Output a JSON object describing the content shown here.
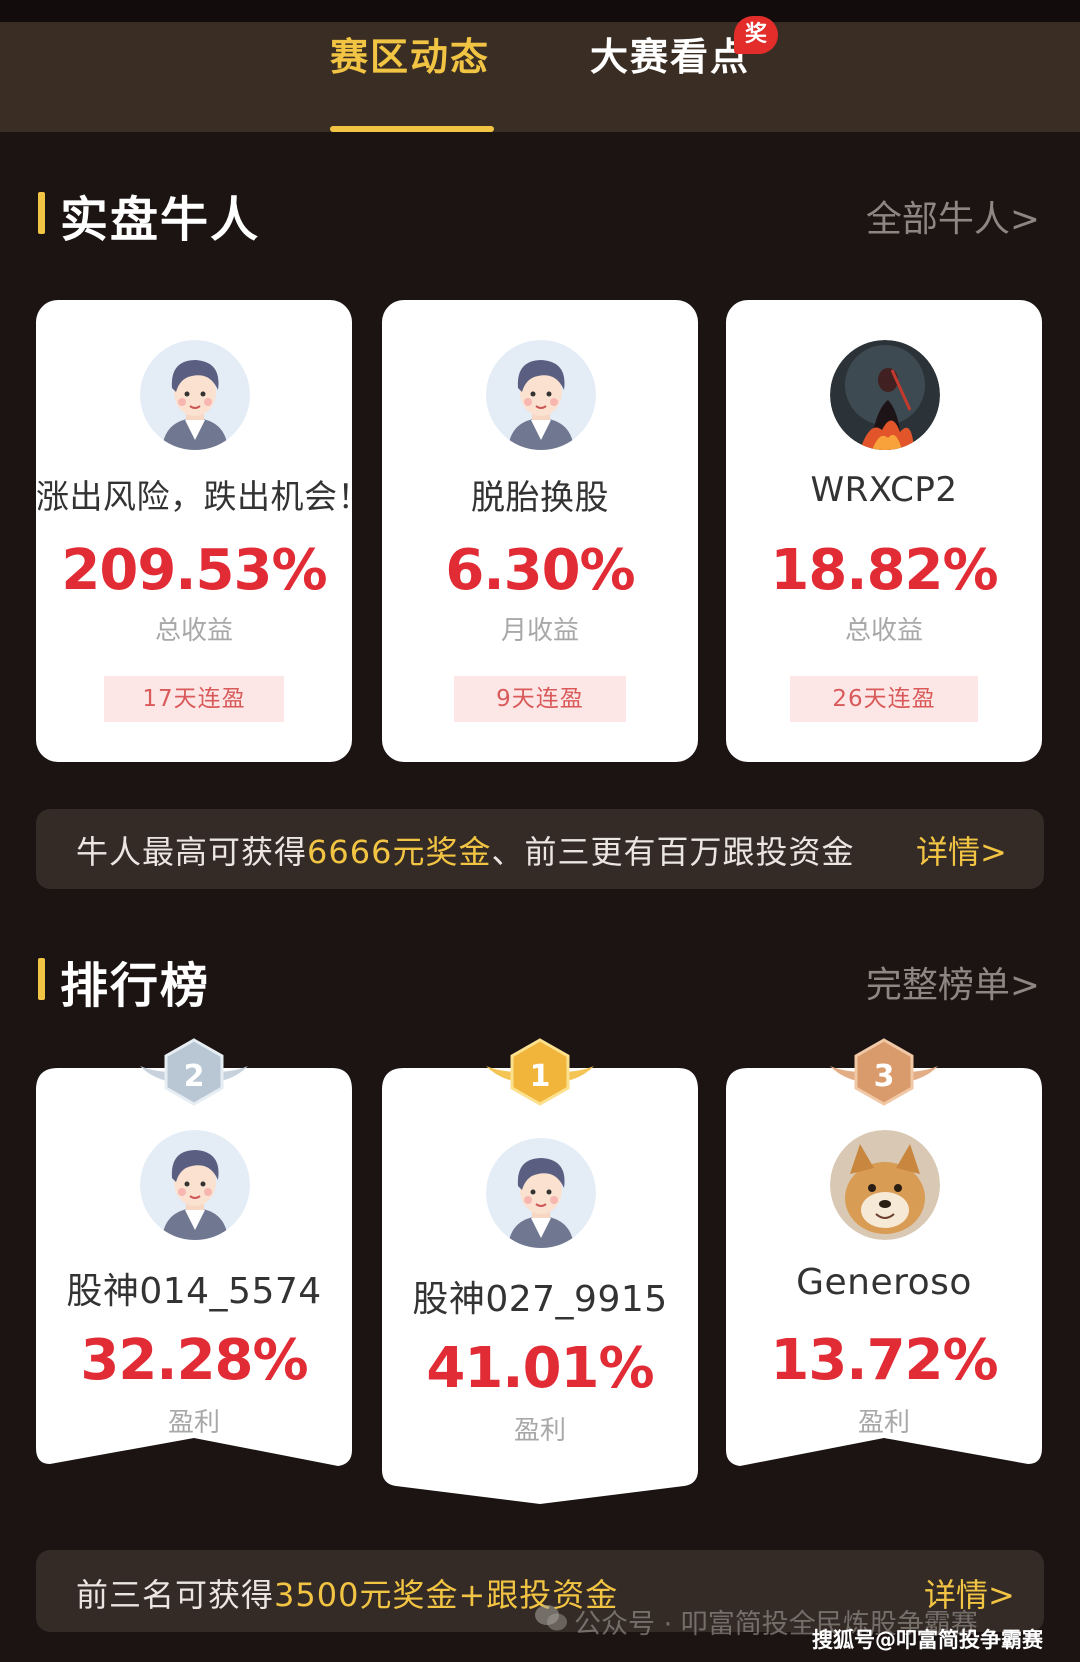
{
  "tabs": {
    "active": "赛区动态",
    "inactive": "大赛看点",
    "badge": "奖"
  },
  "bulls": {
    "title": "实盘牛人",
    "link": "全部牛人>",
    "cards": [
      {
        "name": "涨出风险，跌出机会！",
        "value": "209.53%",
        "caption": "总收益",
        "streak": "17天连盈",
        "avatar": "cartoon-man-avatar"
      },
      {
        "name": "脱胎换股",
        "value": "6.30%",
        "caption": "月收益",
        "streak": "9天连盈",
        "avatar": "cartoon-man-avatar"
      },
      {
        "name": "WRXCP2",
        "value": "18.82%",
        "caption": "总收益",
        "streak": "26天连盈",
        "avatar": "fire-warrior-avatar"
      }
    ],
    "banner": {
      "prefix": "牛人最高可获得",
      "highlight": "6666元奖金",
      "suffix": "、前三更有百万跟投资金",
      "link": "详情>"
    }
  },
  "ranking": {
    "title": "排行榜",
    "link": "完整榜单>",
    "cards": [
      {
        "rank": "2",
        "name": "股神014_5574",
        "value": "32.28%",
        "caption": "盈利",
        "avatar": "cartoon-man-avatar",
        "medal_color": "#b9c7d4"
      },
      {
        "rank": "1",
        "name": "股神027_9915",
        "value": "41.01%",
        "caption": "盈利",
        "avatar": "cartoon-man-avatar",
        "medal_color": "#f1b53b"
      },
      {
        "rank": "3",
        "name": "Generoso",
        "value": "13.72%",
        "caption": "盈利",
        "avatar": "shiba-dog-avatar",
        "medal_color": "#d99a6c"
      }
    ],
    "banner": {
      "prefix": "前三名可获得",
      "highlight": "3500元奖金+跟投资金",
      "link": "详情>"
    }
  },
  "watermark": {
    "text": "公众号 · 叩富简投全民炼股争霸赛",
    "corner": "搜狐号@叩富简投争霸赛"
  },
  "colors": {
    "accent": "#f2c443",
    "value_red": "#e12b35",
    "background": "#1b1413",
    "tabbar": "#3a2d23"
  }
}
